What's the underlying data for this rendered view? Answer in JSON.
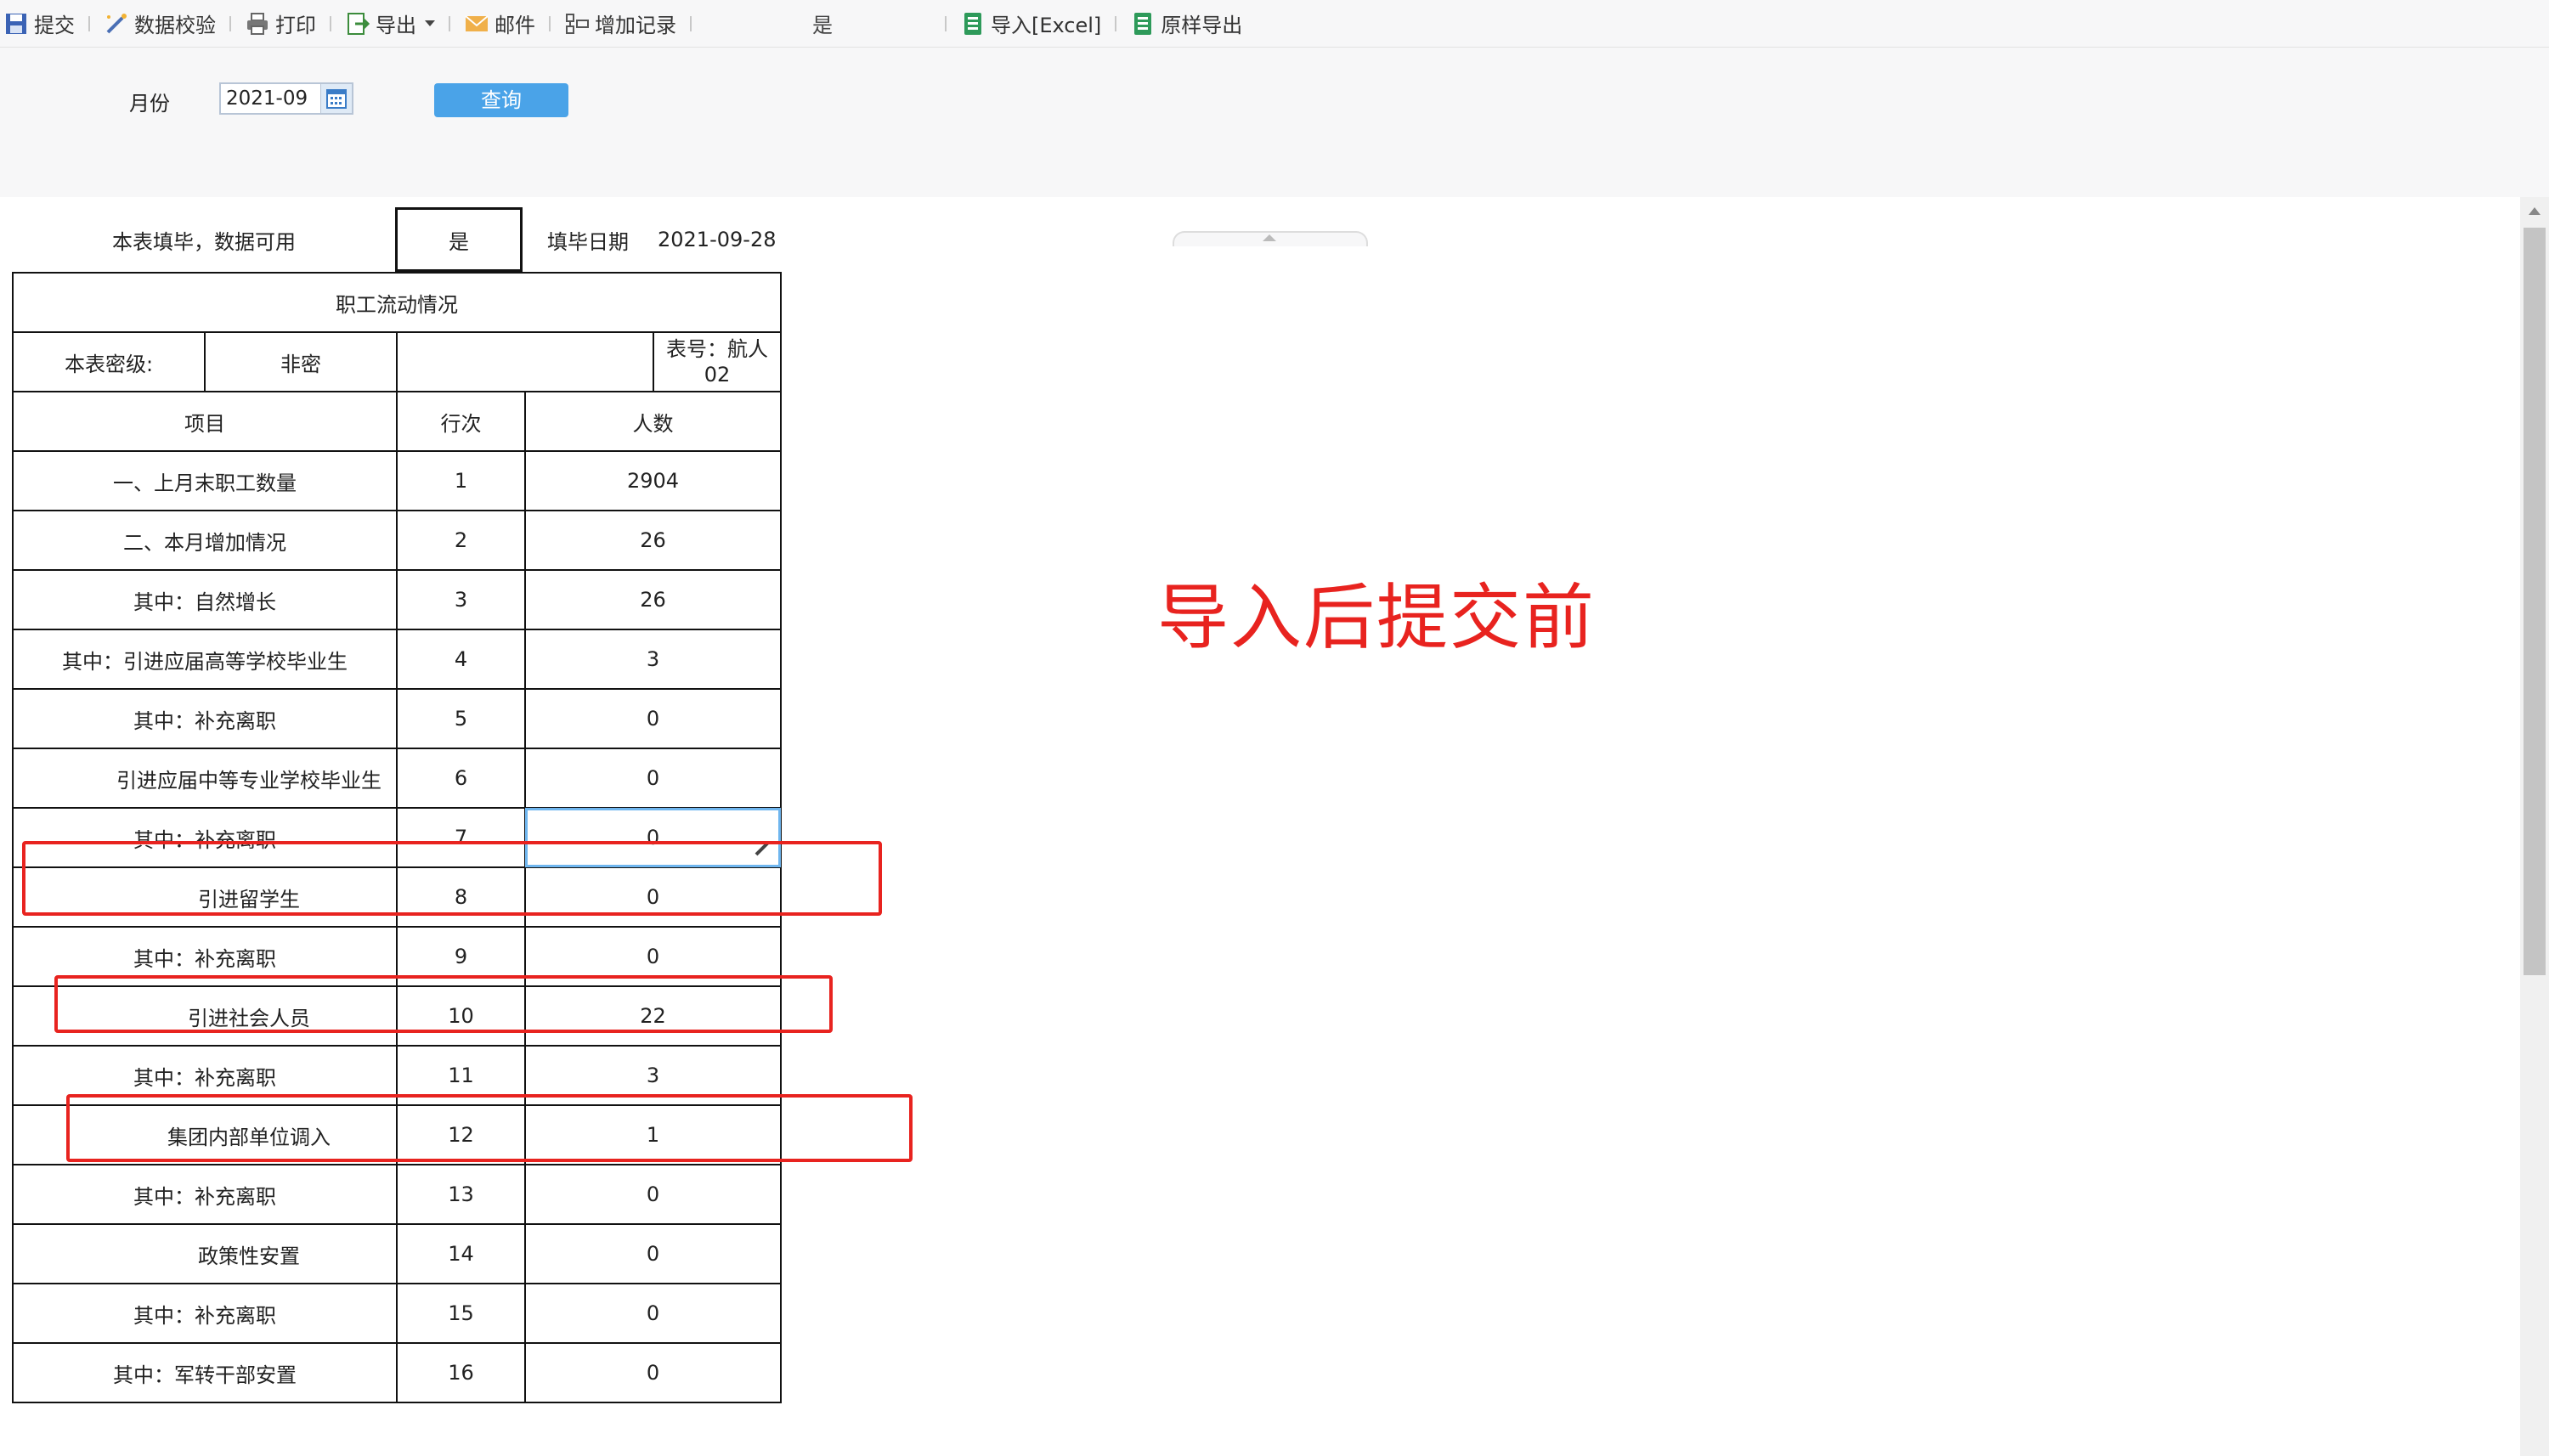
{
  "toolbar": {
    "submit": "提交",
    "validate": "数据校验",
    "print": "打印",
    "export": "导出",
    "mail": "邮件",
    "add_record": "增加记录",
    "yes_value": "是",
    "import_excel": "导入[Excel]",
    "raw_export": "原样导出"
  },
  "query": {
    "month_label": "月份",
    "month_value": "2021-09",
    "query_button": "查询"
  },
  "form": {
    "done_label": "本表填毕，数据可用",
    "done_value": "是",
    "fill_date_label": "填毕日期",
    "fill_date": "2021-09-28",
    "title": "职工流动情况",
    "secrecy_label": "本表密级:",
    "secrecy_value": "非密",
    "table_no_line1": "表号：航人",
    "table_no_line2": "02",
    "headers": {
      "item": "项目",
      "row": "行次",
      "count": "人数"
    },
    "rows": [
      {
        "item": "一、上月末职工数量",
        "row": "1",
        "count": "2904"
      },
      {
        "item": "二、本月增加情况",
        "row": "2",
        "count": "26"
      },
      {
        "item": "其中：自然增长",
        "row": "3",
        "count": "26"
      },
      {
        "item": "其中：引进应届高等学校毕业生",
        "row": "4",
        "count": "3"
      },
      {
        "item": "其中：补充离职",
        "row": "5",
        "count": "0"
      },
      {
        "item": "引进应届中等专业学校毕业生",
        "row": "6",
        "count": "0"
      },
      {
        "item": "其中：补充离职",
        "row": "7",
        "count": "0"
      },
      {
        "item": "引进留学生",
        "row": "8",
        "count": "0"
      },
      {
        "item": "其中：补充离职",
        "row": "9",
        "count": "0"
      },
      {
        "item": "引进社会人员",
        "row": "10",
        "count": "22"
      },
      {
        "item": "其中：补充离职",
        "row": "11",
        "count": "3"
      },
      {
        "item": "集团内部单位调入",
        "row": "12",
        "count": "1"
      },
      {
        "item": "其中：补充离职",
        "row": "13",
        "count": "0"
      },
      {
        "item": "政策性安置",
        "row": "14",
        "count": "0"
      },
      {
        "item": "其中：补充离职",
        "row": "15",
        "count": "0"
      },
      {
        "item": "其中：军转干部安置",
        "row": "16",
        "count": "0"
      }
    ]
  },
  "annotation": {
    "title": "导入后提交前",
    "color": "#e8231f"
  },
  "colors": {
    "accent": "#4aa3e8",
    "toolbar_bg": "#f7f7f8",
    "selection": "#6fb6ef"
  }
}
